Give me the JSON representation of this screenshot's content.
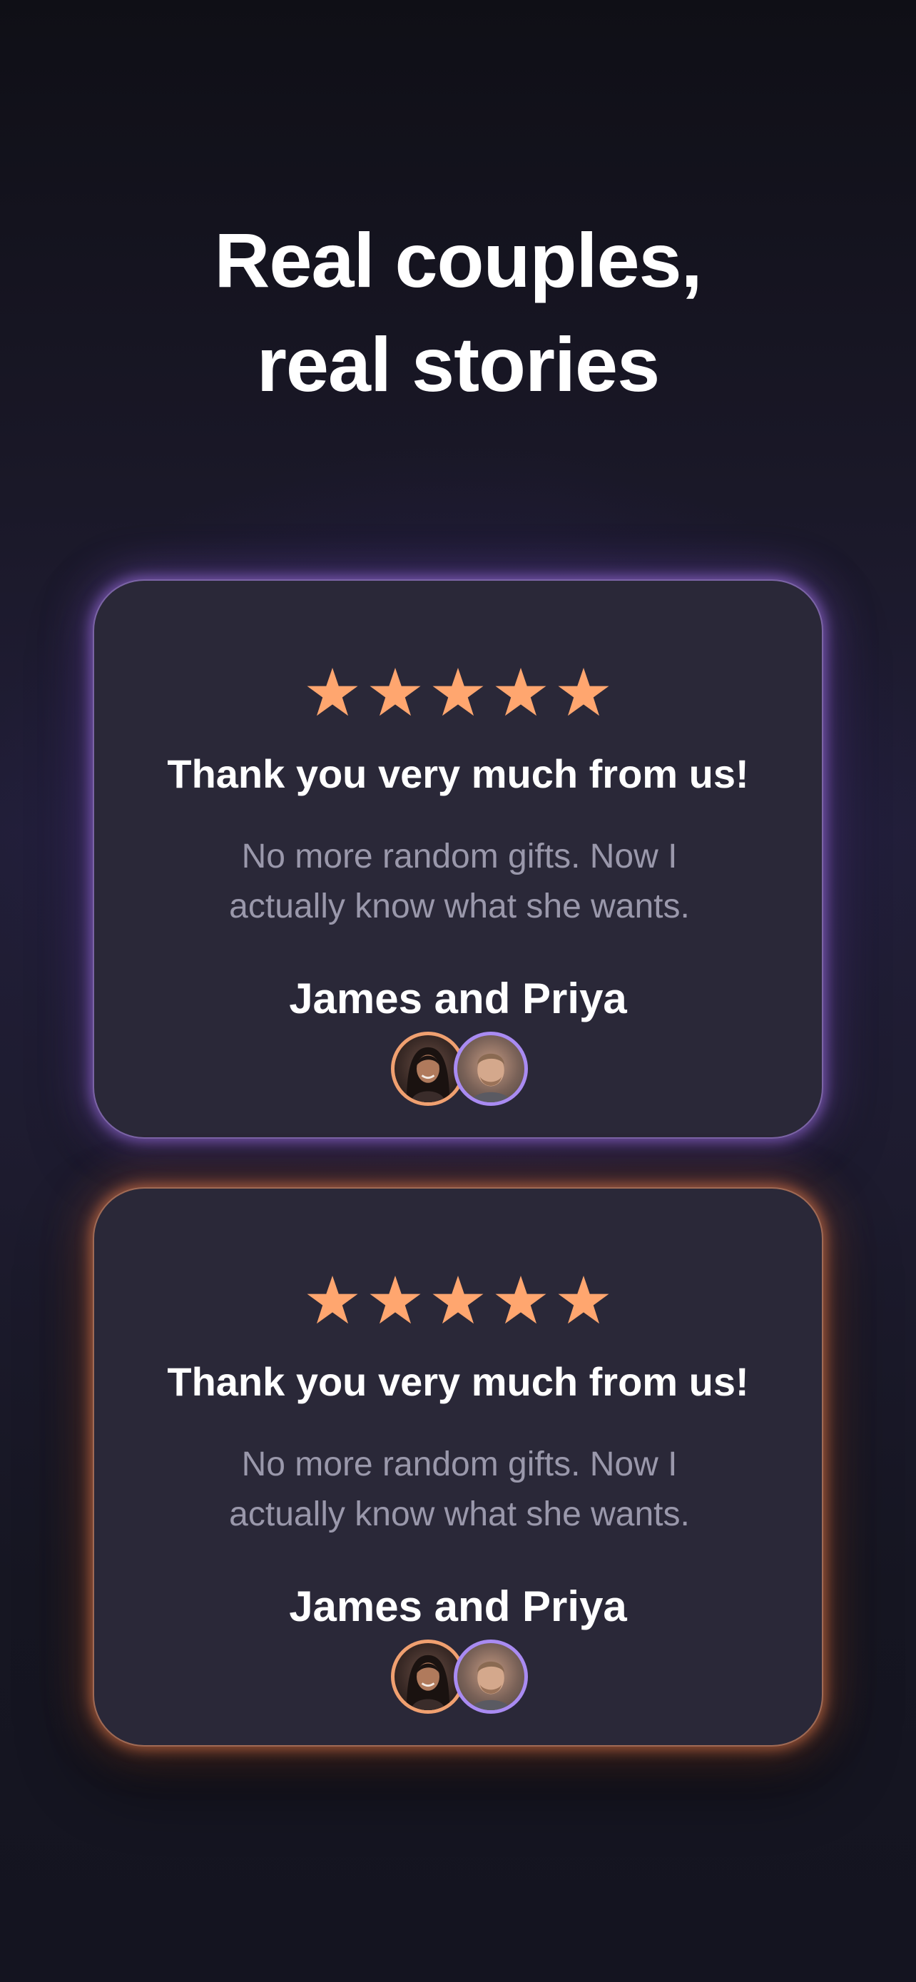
{
  "headline": {
    "line1": "Real couples,",
    "line2": "real stories"
  },
  "colors": {
    "star": "#ffa66f",
    "purple_glow": "#a87cf0",
    "orange_glow": "#f08a50",
    "card_bg": "#2a2838"
  },
  "reviews": [
    {
      "rating": 5,
      "title": "Thank you very much from us!",
      "body_line1": "No more random gifts. Now I",
      "body_line2": "actually know what she wants.",
      "names": "James and Priya",
      "glow": "purple",
      "avatars": [
        "woman-avatar",
        "man-avatar"
      ]
    },
    {
      "rating": 5,
      "title": "Thank you very much from us!",
      "body_line1": "No more random gifts. Now I",
      "body_line2": "actually know what she wants.",
      "names": "James and Priya",
      "glow": "orange",
      "avatars": [
        "woman-avatar",
        "man-avatar"
      ]
    }
  ]
}
